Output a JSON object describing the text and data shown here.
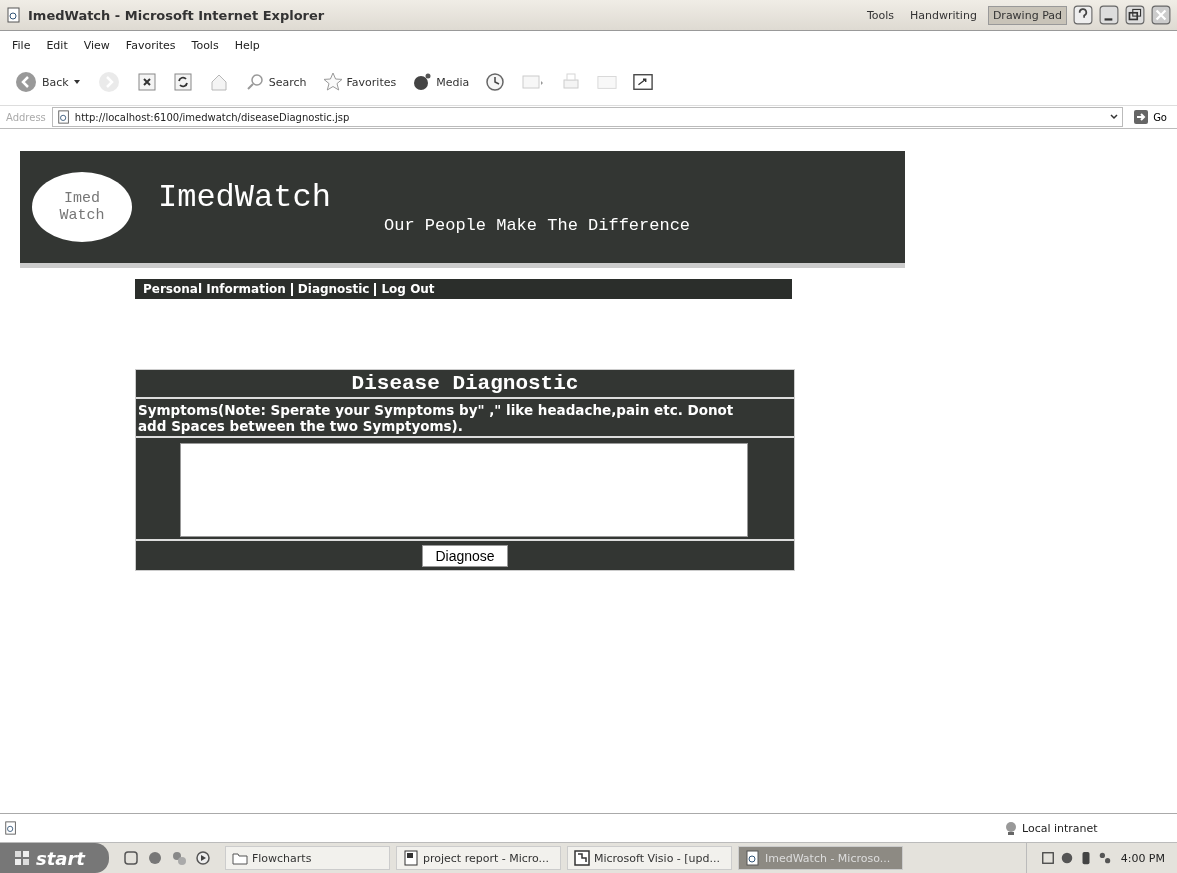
{
  "window": {
    "title": "ImedWatch - Microsoft Internet Explorer"
  },
  "tablet_toolbar": [
    {
      "label": "Tools",
      "selected": false
    },
    {
      "label": "Handwriting",
      "selected": false
    },
    {
      "label": "Drawing Pad",
      "selected": true
    }
  ],
  "menu": [
    "File",
    "Edit",
    "View",
    "Favorites",
    "Tools",
    "Help"
  ],
  "toolbar": [
    {
      "kind": "back",
      "label": "Back"
    },
    {
      "kind": "forward"
    },
    {
      "kind": "stop"
    },
    {
      "kind": "refresh"
    },
    {
      "kind": "home"
    },
    {
      "kind": "search",
      "label": "Search"
    },
    {
      "kind": "favorites",
      "label": "Favorites"
    },
    {
      "kind": "media",
      "label": "Media"
    },
    {
      "kind": "history"
    },
    {
      "kind": "mail"
    },
    {
      "kind": "print"
    },
    {
      "kind": "edit"
    },
    {
      "kind": "discuss"
    }
  ],
  "address": {
    "label": "Address",
    "value": "http://localhost:6100/imedwatch/diseaseDiagnostic.jsp",
    "go": "Go"
  },
  "banner": {
    "logo": [
      "Imed",
      "Watch"
    ],
    "title": "ImedWatch",
    "slogan": "Our People Make The Difference"
  },
  "nav": [
    "Personal Information",
    "Diagnostic",
    "Log Out"
  ],
  "form": {
    "title": "Disease Diagnostic",
    "instructions": "Symptoms(Note: Sperate your Symptoms by\" ,\" like headache,pain etc. Donot add Spaces between the two Symptyoms).",
    "button": "Diagnose"
  },
  "status_bar": {
    "zone": "Local intranet"
  },
  "taskbar": {
    "start": "start",
    "tasks": [
      {
        "label": "Flowcharts",
        "kind": "folder",
        "selected": false
      },
      {
        "label": "project report - Micro...",
        "kind": "word",
        "selected": false
      },
      {
        "label": "Microsoft Visio - [upd...",
        "kind": "visio",
        "selected": false
      },
      {
        "label": "ImedWatch - Microso...",
        "kind": "ie",
        "selected": true
      }
    ],
    "clock": "4:00 PM"
  }
}
